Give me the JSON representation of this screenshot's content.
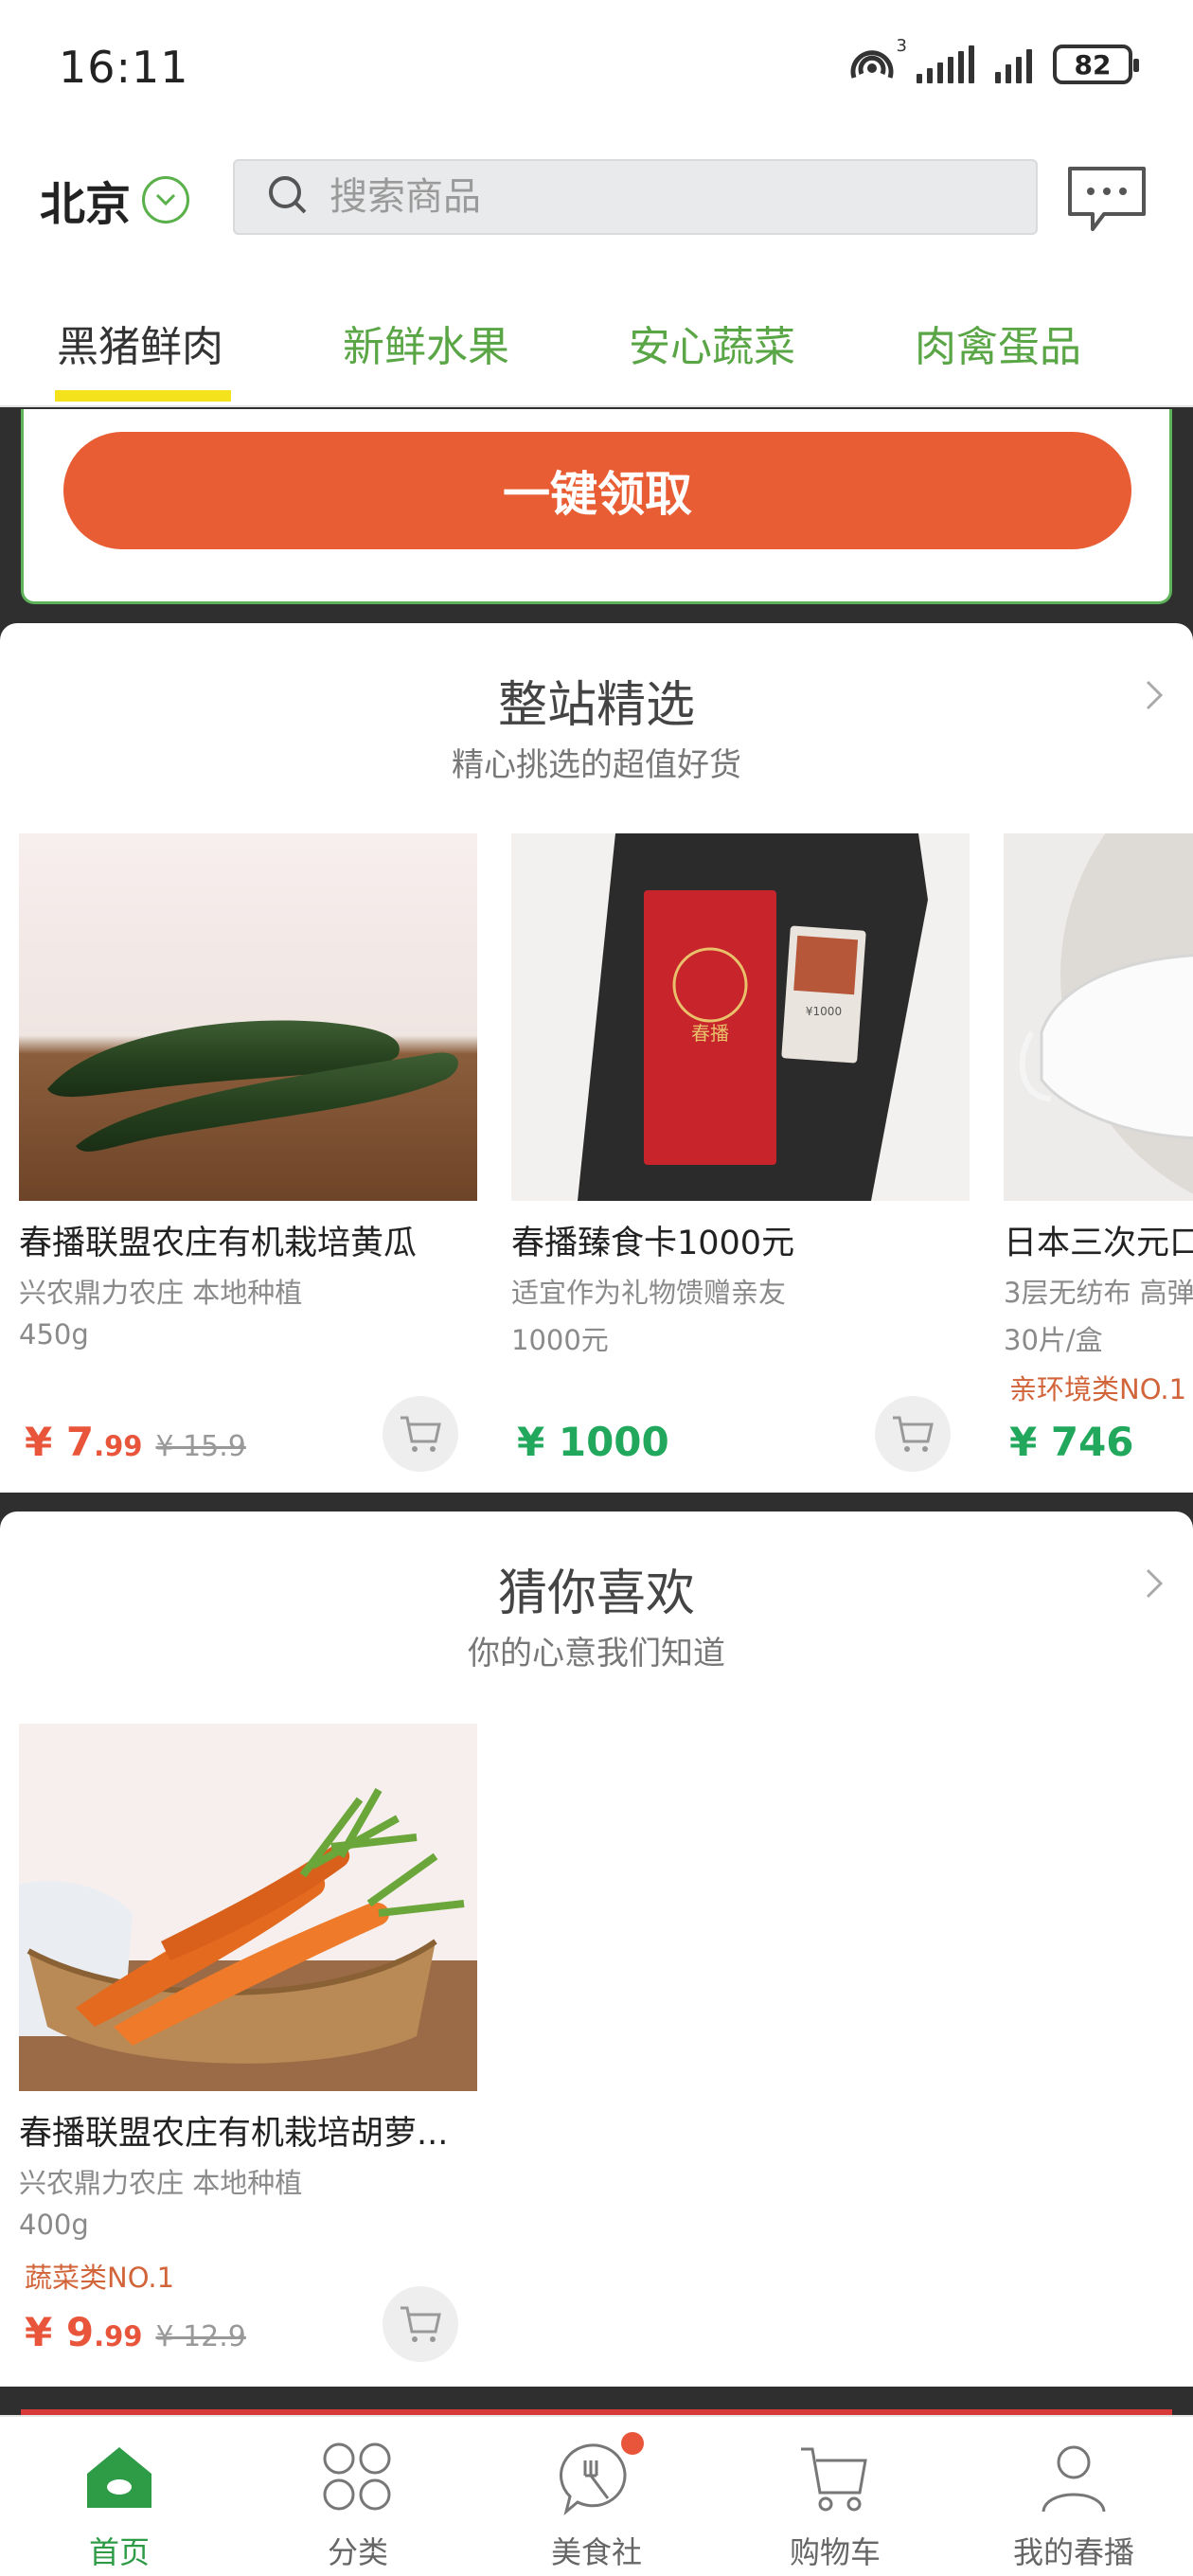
{
  "status_bar": {
    "time": "16:11",
    "battery": "82",
    "network_label": "3"
  },
  "header": {
    "city": "北京",
    "search_placeholder": "搜索商品"
  },
  "tabs": [
    "黑猪鲜肉",
    "新鲜水果",
    "安心蔬菜",
    "肉禽蛋品"
  ],
  "coupon": {
    "claim_label": "一键领取"
  },
  "featured": {
    "title": "整站精选",
    "subtitle": "精心挑选的超值好货",
    "items": [
      {
        "name": "春播联盟农庄有机栽培黄瓜",
        "desc1": "兴农鼎力农庄 本地种植",
        "desc2": "450g",
        "price_main": "¥ 7",
        "price_cents": ".99",
        "old_price": "¥ 15.9"
      },
      {
        "name": "春播臻食卡1000元",
        "desc1": "适宜作为礼物馈赠亲友",
        "desc2": "1000元",
        "price_main": "¥ 1000"
      },
      {
        "name": "日本三次元口",
        "desc1": "3层无纺布 高弹",
        "desc2": "30片/盒",
        "tag": "亲环境类NO.1",
        "price_main": "¥ 746"
      }
    ]
  },
  "recommend": {
    "title": "猜你喜欢",
    "subtitle": "你的心意我们知道",
    "items": [
      {
        "name": "春播联盟农庄有机栽培胡萝...",
        "desc1": "兴农鼎力农庄 本地种植",
        "desc2": "400g",
        "tag": "蔬菜类NO.1",
        "price_main": "¥ 9",
        "price_cents": ".99",
        "old_price": "¥ 12.9"
      }
    ]
  },
  "card_art": {
    "label": "春播",
    "value": "¥1000"
  },
  "bottom_nav": [
    "首页",
    "分类",
    "美食社",
    "购物车",
    "我的春播"
  ],
  "colors": {
    "accent_green": "#2e9b46",
    "tab_green": "#5aa646",
    "claim_orange": "#e85d33",
    "price_red": "#e8553b",
    "price_green": "#21a85c",
    "underline_yellow": "#f4e21d"
  }
}
